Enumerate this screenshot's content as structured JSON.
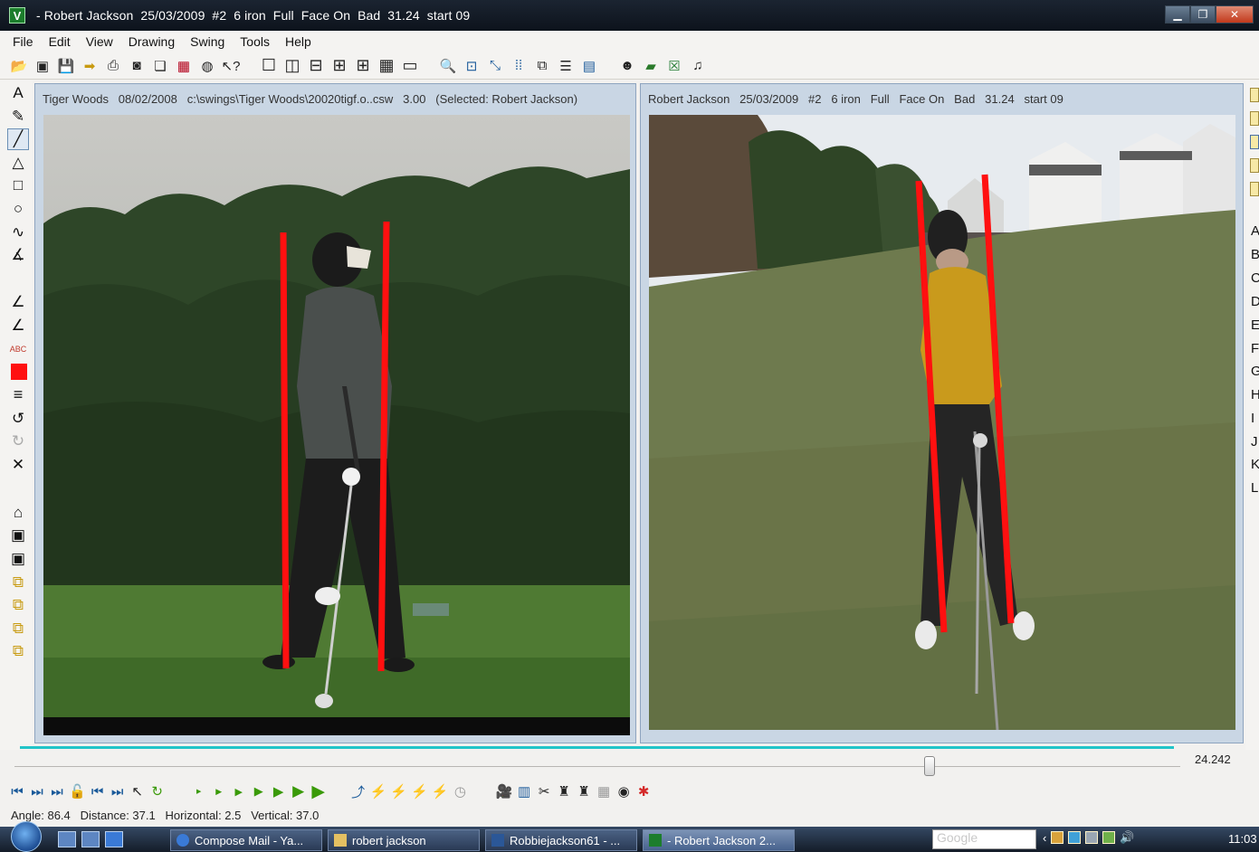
{
  "window": {
    "title": " - Robert Jackson  25/03/2009  #2  6 iron  Full  Face On  Bad  31.24  start 09",
    "controls": [
      "minimize",
      "restore",
      "close"
    ]
  },
  "menu": [
    "File",
    "Edit",
    "View",
    "Drawing",
    "Swing",
    "Tools",
    "Help"
  ],
  "toolbar_icons": [
    "open-folder-icon",
    "open-swing-icon",
    "save-icon",
    "arrow-right-icon",
    "print-icon",
    "capture-icon",
    "copy-icon",
    "film-icon",
    "globe-icon",
    "help-cursor-icon",
    "single-view-icon",
    "two-vertical-icon",
    "two-horizontal-icon",
    "three-view-icon",
    "four-view-icon",
    "grid-view-icon",
    "monitor-icon",
    "zoom-icon",
    "zoom-fit-icon",
    "select-icon",
    "align-icon",
    "overlay-icon",
    "list-icon",
    "window-icon",
    "user-icon",
    "notes-icon",
    "excel-icon",
    "music-icon"
  ],
  "drawing_tools": [
    "text-tool-icon",
    "pencil-tool-icon",
    "line-tool-icon",
    "triangle-tool-icon",
    "rectangle-tool-icon",
    "circle-tool-icon",
    "curve-tool-icon",
    "angle-tool-icon",
    "angle-measure-icon",
    "angle-line-icon",
    "abc-label-icon",
    "color-swatch-red",
    "line-width-icon",
    "undo-icon",
    "redo-icon",
    "delete-icon",
    "library-icon",
    "frame1-icon",
    "frame2-icon",
    "layer1-icon",
    "layer2-icon",
    "layer3-icon",
    "layer4-icon"
  ],
  "drawing_labels": {
    "text": "A",
    "abc": "ABC"
  },
  "right_letters": [
    "A",
    "B",
    "C",
    "D",
    "E",
    "F",
    "G",
    "H",
    "I",
    "J",
    "K",
    "L"
  ],
  "left_pane": {
    "header": "Tiger Woods   08/02/2008   c:\\swings\\Tiger Woods\\20020tigf.o..csw   3.00   (Selected: Robert Jackson)"
  },
  "right_pane": {
    "header": "Robert Jackson   25/03/2009   #2   6 iron   Full   Face On   Bad   31.24   start 09"
  },
  "timeline": {
    "value": "24.242",
    "position_fraction": 0.785
  },
  "transport_icons": [
    "go-start-icon",
    "step-back-icon",
    "go-end-icon",
    "lock-icon",
    "prev-frame-icon",
    "next-frame-icon",
    "cursor-icon",
    "loop-icon",
    "speed-1-icon",
    "speed-2-icon",
    "speed-3-icon",
    "speed-4-icon",
    "speed-5-icon",
    "speed-6-icon",
    "speed-7-icon",
    "draw-skeleton-icon",
    "pose1-icon",
    "pose2-icon",
    "pose3-icon",
    "pose4-icon",
    "timer-icon",
    "camera-icon",
    "video-icon",
    "cut-icon",
    "person1-icon",
    "person2-icon",
    "grid-person-icon",
    "target-icon",
    "color-dots-icon"
  ],
  "status": {
    "text": "Angle: 86.4   Distance: 37.1   Horizontal: 2.5   Vertical: 37.0"
  },
  "taskbar": {
    "tasks": [
      {
        "label": "Compose Mail - Ya...",
        "active": false
      },
      {
        "label": "robert jackson",
        "active": false
      },
      {
        "label": "Robbiejackson61 - ...",
        "active": false
      },
      {
        "label": " - Robert Jackson  2...",
        "active": true
      }
    ],
    "search_placeholder": "Google",
    "clock": "11:03"
  },
  "colors": {
    "guide_line": "#ff1010",
    "timeline": "#22c4c8",
    "pane_frame": "#c9d6e4"
  }
}
